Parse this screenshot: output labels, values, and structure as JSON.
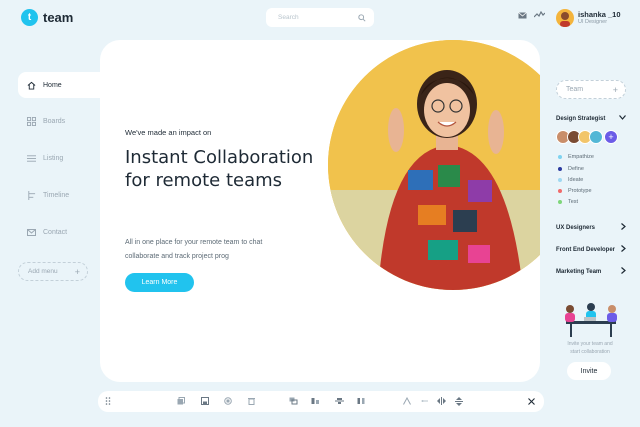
{
  "app": {
    "logo_letter": "t",
    "name": "team"
  },
  "search": {
    "placeholder": "Search"
  },
  "user": {
    "name": "ishanka _10",
    "role": "UI Designer"
  },
  "sidebar": {
    "items": [
      {
        "label": "Home",
        "icon": "home-icon",
        "active": true
      },
      {
        "label": "Boards",
        "icon": "boards-icon",
        "active": false
      },
      {
        "label": "Listing",
        "icon": "list-icon",
        "active": false
      },
      {
        "label": "Timeline",
        "icon": "timeline-icon",
        "active": false
      },
      {
        "label": "Contact",
        "icon": "mail-icon",
        "active": false
      }
    ],
    "add_menu": "Add menu"
  },
  "hero": {
    "kicker": "We've made an impact on",
    "headline_line1": "Instant Collaboration",
    "headline_line2": "for remote teams",
    "body_line1": "All in one place  for your remote team to chat",
    "body_line2": "collaborate and track project prog",
    "cta": "Learn More"
  },
  "right_panel": {
    "team_field": "Team",
    "groups": [
      {
        "name": "Design Strategist",
        "expanded": true
      },
      {
        "name": "UX Designers",
        "expanded": false
      },
      {
        "name": "Front End Developer",
        "expanded": false
      },
      {
        "name": "Marketing Team",
        "expanded": false
      }
    ],
    "subitems": [
      {
        "label": "Empathize",
        "color": "#7fd3f0"
      },
      {
        "label": "Define",
        "color": "#2b3a9f"
      },
      {
        "label": "Ideate",
        "color": "#9fd8f2"
      },
      {
        "label": "Prototype",
        "color": "#f06b6b"
      },
      {
        "label": "Test",
        "color": "#7ed67a"
      }
    ],
    "invite_line1": "Invite your team and",
    "invite_line2": "start collaboration",
    "invite_button": "Invite"
  },
  "colors": {
    "accent": "#21c3ee",
    "background": "#eaf4f9",
    "purple": "#6c5ce7"
  }
}
